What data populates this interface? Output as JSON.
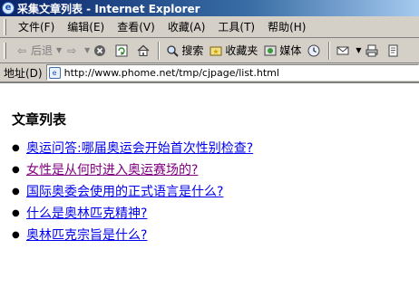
{
  "window": {
    "title": "采集文章列表 - Internet Explorer"
  },
  "menu": [
    "文件(F)",
    "编辑(E)",
    "查看(V)",
    "收藏(A)",
    "工具(T)",
    "帮助(H)"
  ],
  "toolbar": {
    "back_label": "后退",
    "search_label": "搜索",
    "favorites_label": "收藏夹",
    "media_label": "媒体"
  },
  "address": {
    "label": "地址(D)",
    "url": "http://www.phome.net/tmp/cjpage/list.html"
  },
  "page": {
    "heading": "文章列表",
    "articles": [
      {
        "title": "奥运问答:哪届奥运会开始首次性别检查?",
        "visited": false
      },
      {
        "title": "女性是从何时进入奥运赛场的?",
        "visited": true
      },
      {
        "title": "国际奥委会使用的正式语言是什么?",
        "visited": false
      },
      {
        "title": "什么是奥林匹克精神?",
        "visited": false
      },
      {
        "title": "奥林匹克宗旨是什么?",
        "visited": false
      }
    ]
  },
  "colors": {
    "link": "#0000ee",
    "visited_link": "#800080",
    "chrome": "#d4d0c8",
    "titlebar": "#0a246a"
  }
}
